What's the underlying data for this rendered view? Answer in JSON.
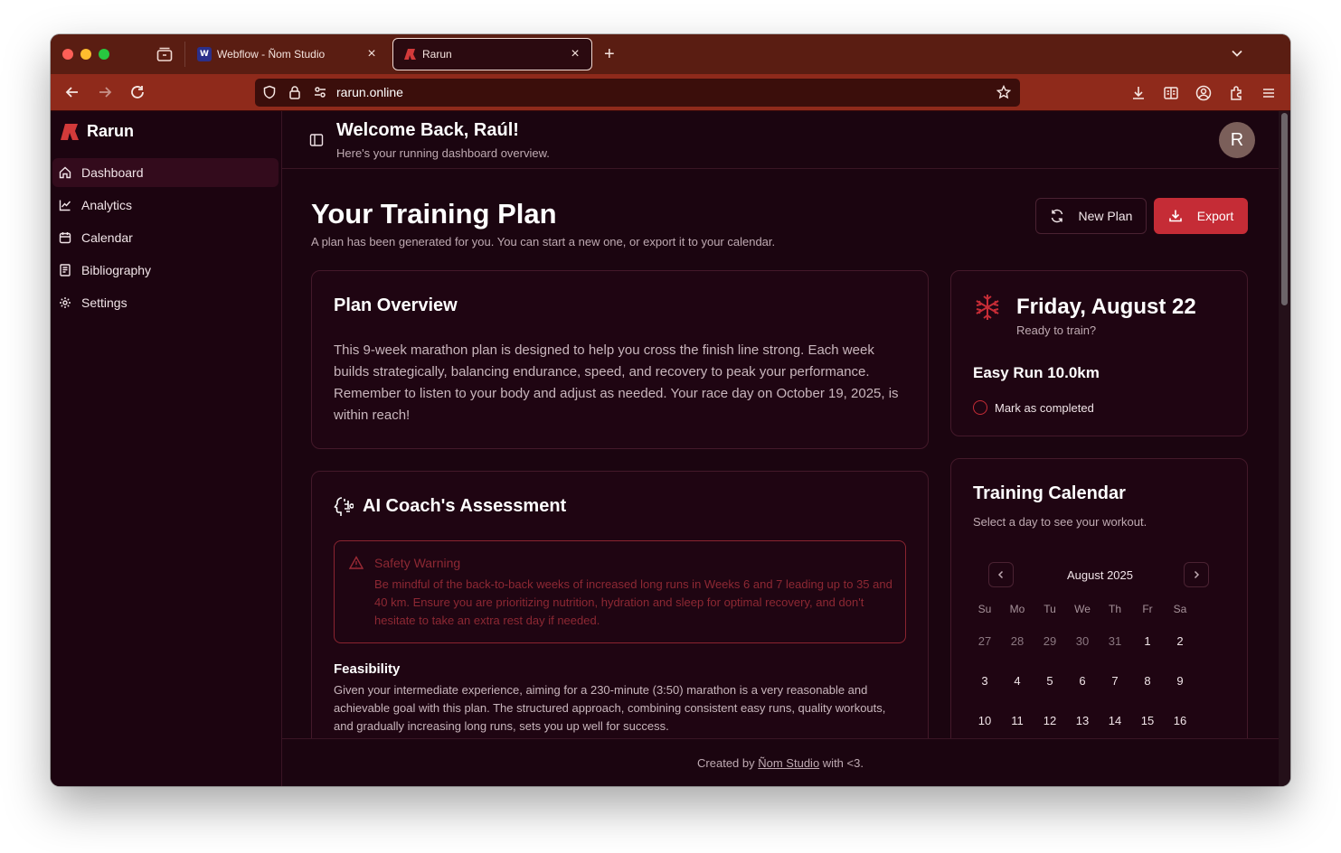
{
  "browser": {
    "tabs": [
      {
        "title": "Webflow - Ñom Studio",
        "favicon": "webflow-icon",
        "active": false
      },
      {
        "title": "Rarun",
        "favicon": "rarun-logo-icon",
        "active": true
      }
    ],
    "url": "rarun.online"
  },
  "sidebar": {
    "brand": "Rarun",
    "items": [
      {
        "label": "Dashboard",
        "icon": "home-icon",
        "active": true
      },
      {
        "label": "Analytics",
        "icon": "chart-line-icon",
        "active": false
      },
      {
        "label": "Calendar",
        "icon": "calendar-icon",
        "active": false
      },
      {
        "label": "Bibliography",
        "icon": "book-icon",
        "active": false
      },
      {
        "label": "Settings",
        "icon": "gear-icon",
        "active": false
      }
    ]
  },
  "header": {
    "title": "Welcome Back, Raúl!",
    "subtitle": "Here's your running dashboard overview.",
    "avatar_initial": "R"
  },
  "page": {
    "title": "Your Training Plan",
    "subtitle": "A plan has been generated for you. You can start a new one, or export it to your calendar.",
    "new_plan_label": "New Plan",
    "export_label": "Export"
  },
  "overview": {
    "title": "Plan Overview",
    "text": "This 9-week marathon plan is designed to help you cross the finish line strong. Each week builds strategically, balancing endurance, speed, and recovery to peak your performance. Remember to listen to your body and adjust as needed. Your race day on October 19, 2025, is within reach!"
  },
  "coach": {
    "title": "AI Coach's Assessment",
    "warning_title": "Safety Warning",
    "warning_text": "Be mindful of the back-to-back weeks of increased long runs in Weeks 6 and 7 leading up to 35 and 40 km. Ensure you are prioritizing nutrition, hydration and sleep for optimal recovery, and don't hesitate to take an extra rest day if needed.",
    "feasibility_title": "Feasibility",
    "feasibility_text": "Given your intermediate experience, aiming for a 230-minute (3:50) marathon is a very reasonable and achievable goal with this plan. The structured approach, combining consistent easy runs, quality workouts, and gradually increasing long runs, sets you up well for success."
  },
  "today": {
    "date": "Friday, August 22",
    "subtitle": "Ready to train?",
    "workout": "Easy Run 10.0km",
    "mark_label": "Mark as completed"
  },
  "calendar": {
    "title": "Training Calendar",
    "subtitle": "Select a day to see your workout.",
    "month": "August 2025",
    "weekdays": [
      "Su",
      "Mo",
      "Tu",
      "We",
      "Th",
      "Fr",
      "Sa"
    ],
    "weeks": [
      [
        "27",
        "28",
        "29",
        "30",
        "31",
        "1",
        "2"
      ],
      [
        "3",
        "4",
        "5",
        "6",
        "7",
        "8",
        "9"
      ],
      [
        "10",
        "11",
        "12",
        "13",
        "14",
        "15",
        "16"
      ]
    ]
  },
  "footer": {
    "prefix": "Created by",
    "link": "Ñom Studio",
    "suffix": "with <3."
  },
  "colors": {
    "accent": "#c52c36",
    "background": "#1b0510",
    "toolbar": "#8f2a1b"
  }
}
